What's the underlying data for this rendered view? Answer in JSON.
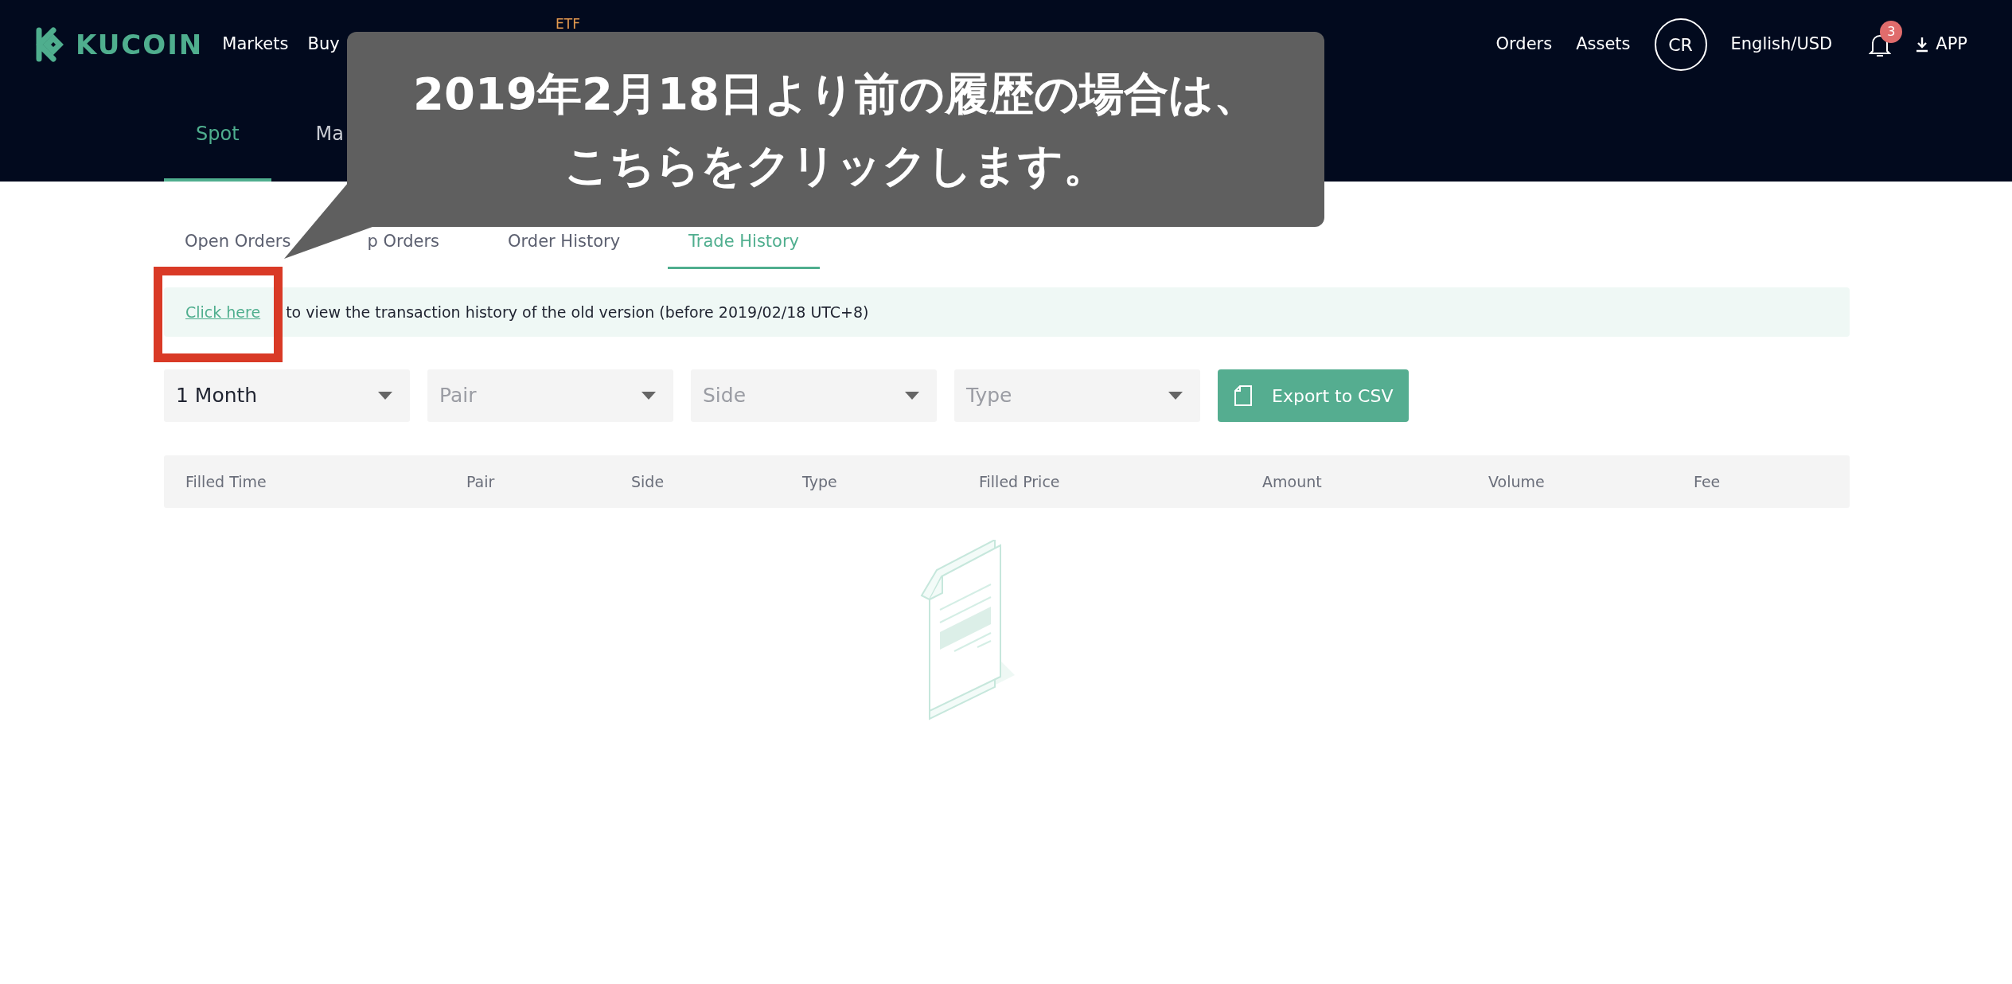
{
  "header": {
    "logo": "KUCOIN",
    "nav": [
      {
        "label": "Markets"
      },
      {
        "label": "Buy"
      }
    ],
    "etf_badge": "ETF",
    "orders": "Orders",
    "assets": "Assets",
    "avatar": "CR",
    "language": "English/USD",
    "notifications": "3",
    "app": "APP"
  },
  "subnav": [
    {
      "label": "Spot",
      "selected": true
    },
    {
      "label": "Ma",
      "selected": false
    }
  ],
  "callout": {
    "lines": [
      "2019年2月18日より前の履歴の場合は、",
      "こちらをクリックします。"
    ]
  },
  "tabs": [
    {
      "label": "Open Orders",
      "selected": false
    },
    {
      "label": "p Orders",
      "selected": false
    },
    {
      "label": "Order History",
      "selected": false
    },
    {
      "label": "Trade History",
      "selected": true
    }
  ],
  "notice": {
    "link": "Click here",
    "text": "to view the transaction history of the old version (before 2019/02/18 UTC+8)",
    "highlighted": true
  },
  "filters": [
    {
      "value": "1 Month"
    },
    {
      "placeholder": "Pair"
    },
    {
      "placeholder": "Side"
    },
    {
      "placeholder": "Type"
    }
  ],
  "export_button": "Export to CSV",
  "table": {
    "columns": [
      "Filled Time",
      "Pair",
      "Side",
      "Type",
      "Filled Price",
      "Amount",
      "Volume",
      "Fee"
    ]
  }
}
